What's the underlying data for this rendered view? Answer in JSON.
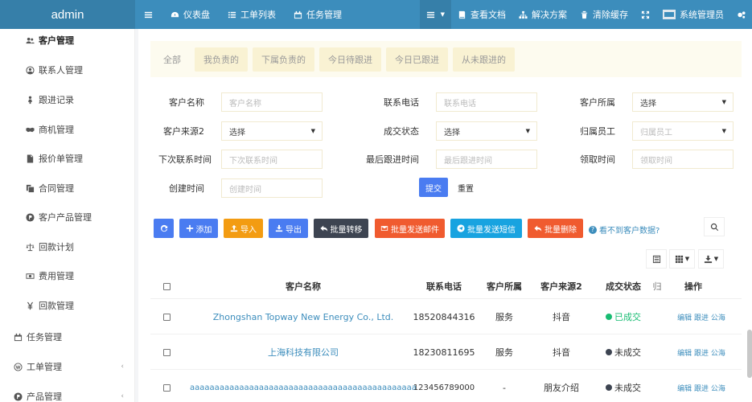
{
  "app": {
    "brand": "admin"
  },
  "topnav": {
    "left": [
      {
        "label": "仪表盘",
        "icon": "dashboard-icon"
      },
      {
        "label": "工单列表",
        "icon": "list-icon"
      },
      {
        "label": "任务管理",
        "icon": "calendar-icon"
      }
    ],
    "right": [
      {
        "label": "查看文档",
        "icon": "book-icon"
      },
      {
        "label": "解决方案",
        "icon": "sitemap-icon"
      },
      {
        "label": "清除缓存",
        "icon": "trash-icon"
      },
      {
        "label": "系统管理员",
        "icon": "avatar-icon"
      }
    ]
  },
  "sidebar": {
    "items": [
      {
        "label": "客户管理",
        "icon": "users-icon"
      },
      {
        "label": "联系人管理",
        "icon": "user-circle-icon"
      },
      {
        "label": "跟进记录",
        "icon": "female-icon"
      },
      {
        "label": "商机管理",
        "icon": "handshake-icon"
      },
      {
        "label": "报价单管理",
        "icon": "file-icon"
      },
      {
        "label": "合同管理",
        "icon": "copy-icon"
      },
      {
        "label": "客户产品管理",
        "icon": "product-hunt-icon"
      },
      {
        "label": "回款计划",
        "icon": "balance-scale-icon"
      },
      {
        "label": "费用管理",
        "icon": "money-icon"
      },
      {
        "label": "回款管理",
        "icon": "yen-icon"
      },
      {
        "label": "任务管理",
        "icon": "calendar-icon"
      },
      {
        "label": "工单管理",
        "icon": "wordpress-icon"
      },
      {
        "label": "产品管理",
        "icon": "product-hunt-icon"
      }
    ]
  },
  "tabs": [
    "全部",
    "我负责的",
    "下属负责的",
    "今日待跟进",
    "今日已跟进",
    "从未跟进的"
  ],
  "filters": {
    "customer_name": {
      "label": "客户名称",
      "placeholder": "客户名称"
    },
    "phone": {
      "label": "联系电话",
      "placeholder": "联系电话"
    },
    "belong": {
      "label": "客户所属",
      "value": "选择"
    },
    "source": {
      "label": "客户来源2",
      "value": "选择"
    },
    "deal_status": {
      "label": "成交状态",
      "value": "选择"
    },
    "owner_staff": {
      "label": "归属员工",
      "value": "归属员工"
    },
    "next_contact": {
      "label": "下次联系时间",
      "placeholder": "下次联系时间"
    },
    "last_follow": {
      "label": "最后跟进时间",
      "placeholder": "最后跟进时间"
    },
    "receive_time": {
      "label": "领取时间",
      "placeholder": "领取时间"
    },
    "create_time": {
      "label": "创建时间",
      "placeholder": "创建时间"
    },
    "submit": "提交",
    "reset": "重置"
  },
  "toolbar": {
    "add": "添加",
    "import": "导入",
    "export": "导出",
    "transfer": "批量转移",
    "email": "批量发送邮件",
    "sms": "批量发送短信",
    "delete": "批量删除",
    "help": "看不到客户数据?"
  },
  "colors": {
    "primary": "#3c8dbc",
    "blue_btn": "#4a7cf1",
    "orange": "#f39c12",
    "dark": "#3d4451",
    "red": "#f05b2f",
    "cyan": "#18a3e0",
    "green_dot": "#18bc72"
  },
  "table": {
    "headers": {
      "name": "客户名称",
      "phone": "联系电话",
      "belong": "客户所属",
      "source": "客户来源2",
      "status": "成交状态",
      "cut": "归",
      "ops": "操作"
    },
    "rows": [
      {
        "name": "Zhongshan Topway New Energy Co., Ltd.",
        "phone": "18520844316",
        "belong": "服务",
        "source": "抖音",
        "status": "已成交",
        "status_color": "#18bc72",
        "ops": "编辑 跟进 公海"
      },
      {
        "name": "上海科技有限公司",
        "phone": "18230811695",
        "belong": "服务",
        "source": "抖音",
        "status": "未成交",
        "status_color": "#3d4451",
        "ops": "编辑 跟进 公海"
      },
      {
        "name": "aaaaaaaaaaaaaaaaaaaaaaaaaaaaaaaaaaaaaaaaaaaaaa",
        "phone": "123456789000",
        "belong": "-",
        "source": "朋友介绍",
        "status": "未成交",
        "status_color": "#3d4451",
        "ops": "编辑 跟进 公海"
      }
    ]
  }
}
